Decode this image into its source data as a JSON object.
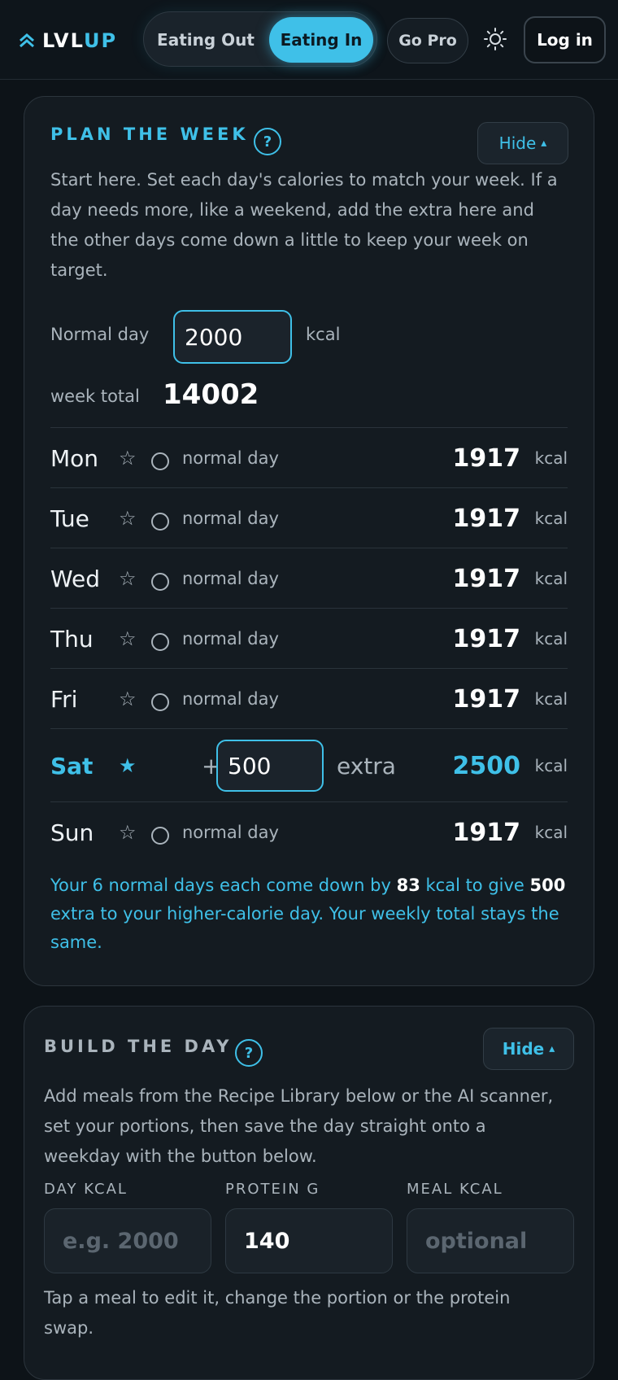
{
  "header": {
    "logo_prefix": "LVL",
    "logo_suffix": "UP",
    "tabs": [
      {
        "label": "Eating Out",
        "active": false
      },
      {
        "label": "Eating In",
        "active": true
      }
    ],
    "go_pro_label": "Go Pro",
    "theme_icon": "sun-icon",
    "login_label": "Log in"
  },
  "colors": {
    "accent": "#3fc0e8",
    "background": "#0d1318",
    "card": "#141b21"
  },
  "plan": {
    "title": "PLAN THE WEEK",
    "help": "?",
    "hide_label": "Hide",
    "hide_glyph": "▴",
    "description": "Start here. Set each day's calories to match your week. If a day needs more, like a weekend, add the extra here and the other days come down a little to keep your week on target.",
    "normal_day_label": "Normal day",
    "normal_day_value": "2000",
    "kcal_label": "kcal",
    "week_total_label": "week total",
    "week_total_value": "14002",
    "days": [
      {
        "day": "Mon",
        "star": "☆",
        "note": "normal day",
        "kcal": "1917",
        "unit": "kcal"
      },
      {
        "day": "Tue",
        "star": "☆",
        "note": "normal day",
        "kcal": "1917",
        "unit": "kcal"
      },
      {
        "day": "Wed",
        "star": "☆",
        "note": "normal day",
        "kcal": "1917",
        "unit": "kcal"
      },
      {
        "day": "Thu",
        "star": "☆",
        "note": "normal day",
        "kcal": "1917",
        "unit": "kcal"
      },
      {
        "day": "Fri",
        "star": "☆",
        "note": "normal day",
        "kcal": "1917",
        "unit": "kcal"
      },
      {
        "day": "Sat",
        "star": "★",
        "plus": "+",
        "extra_value": "500",
        "extra_label": "extra",
        "kcal": "2500",
        "unit": "kcal"
      },
      {
        "day": "Sun",
        "star": "☆",
        "note": "normal day",
        "kcal": "1917",
        "unit": "kcal"
      }
    ],
    "summary": {
      "p1": "Your 6 normal days each come down by ",
      "b1": "83",
      "p2": " kcal to give ",
      "b2": "500",
      "p3": " extra to your higher-calorie day. Your weekly total stays the same."
    }
  },
  "build": {
    "title": "BUILD THE DAY",
    "help": "?",
    "hide_label": "Hide",
    "hide_glyph": "▴",
    "description": "Add meals from the Recipe Library below or the AI scanner, set your portions, then save the day straight onto a weekday with the button below.",
    "fields": [
      {
        "label": "DAY KCAL",
        "placeholder": "e.g. 2000",
        "value": ""
      },
      {
        "label": "PROTEIN G",
        "placeholder": "",
        "value": "140"
      },
      {
        "label": "MEAL KCAL",
        "placeholder": "optional",
        "value": ""
      }
    ],
    "hint": "Tap a meal to edit it, change the portion or the protein swap."
  }
}
